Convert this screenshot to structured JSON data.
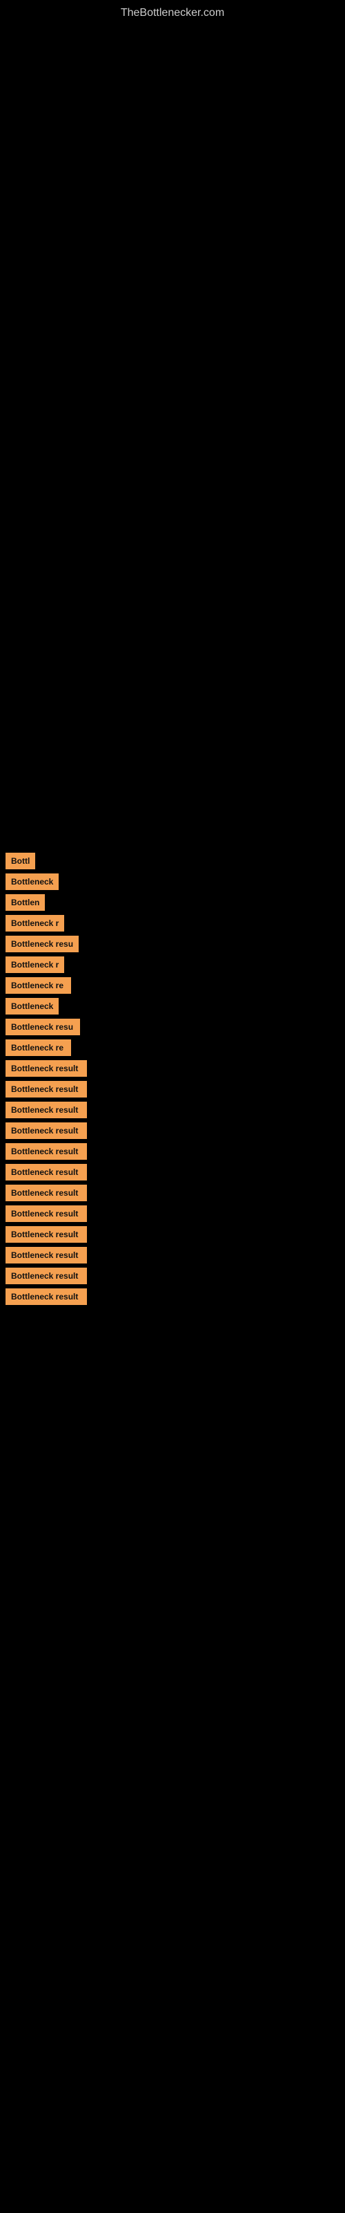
{
  "site": {
    "title": "TheBottlenecker.com"
  },
  "items": [
    {
      "label": "Bottl",
      "width": 38
    },
    {
      "label": "Bottleneck",
      "width": 72
    },
    {
      "label": "Bottlen",
      "width": 52
    },
    {
      "label": "Bottleneck r",
      "width": 85
    },
    {
      "label": "Bottleneck resu",
      "width": 105
    },
    {
      "label": "Bottleneck r",
      "width": 85
    },
    {
      "label": "Bottleneck re",
      "width": 95
    },
    {
      "label": "Bottleneck",
      "width": 75
    },
    {
      "label": "Bottleneck resu",
      "width": 108
    },
    {
      "label": "Bottleneck re",
      "width": 95
    },
    {
      "label": "Bottleneck result",
      "width": 118
    },
    {
      "label": "Bottleneck result",
      "width": 118
    },
    {
      "label": "Bottleneck result",
      "width": 118
    },
    {
      "label": "Bottleneck result",
      "width": 118
    },
    {
      "label": "Bottleneck result",
      "width": 118
    },
    {
      "label": "Bottleneck result",
      "width": 118
    },
    {
      "label": "Bottleneck result",
      "width": 118
    },
    {
      "label": "Bottleneck result",
      "width": 118
    },
    {
      "label": "Bottleneck result",
      "width": 118
    },
    {
      "label": "Bottleneck result",
      "width": 118
    },
    {
      "label": "Bottleneck result",
      "width": 118
    },
    {
      "label": "Bottleneck result",
      "width": 118
    }
  ]
}
